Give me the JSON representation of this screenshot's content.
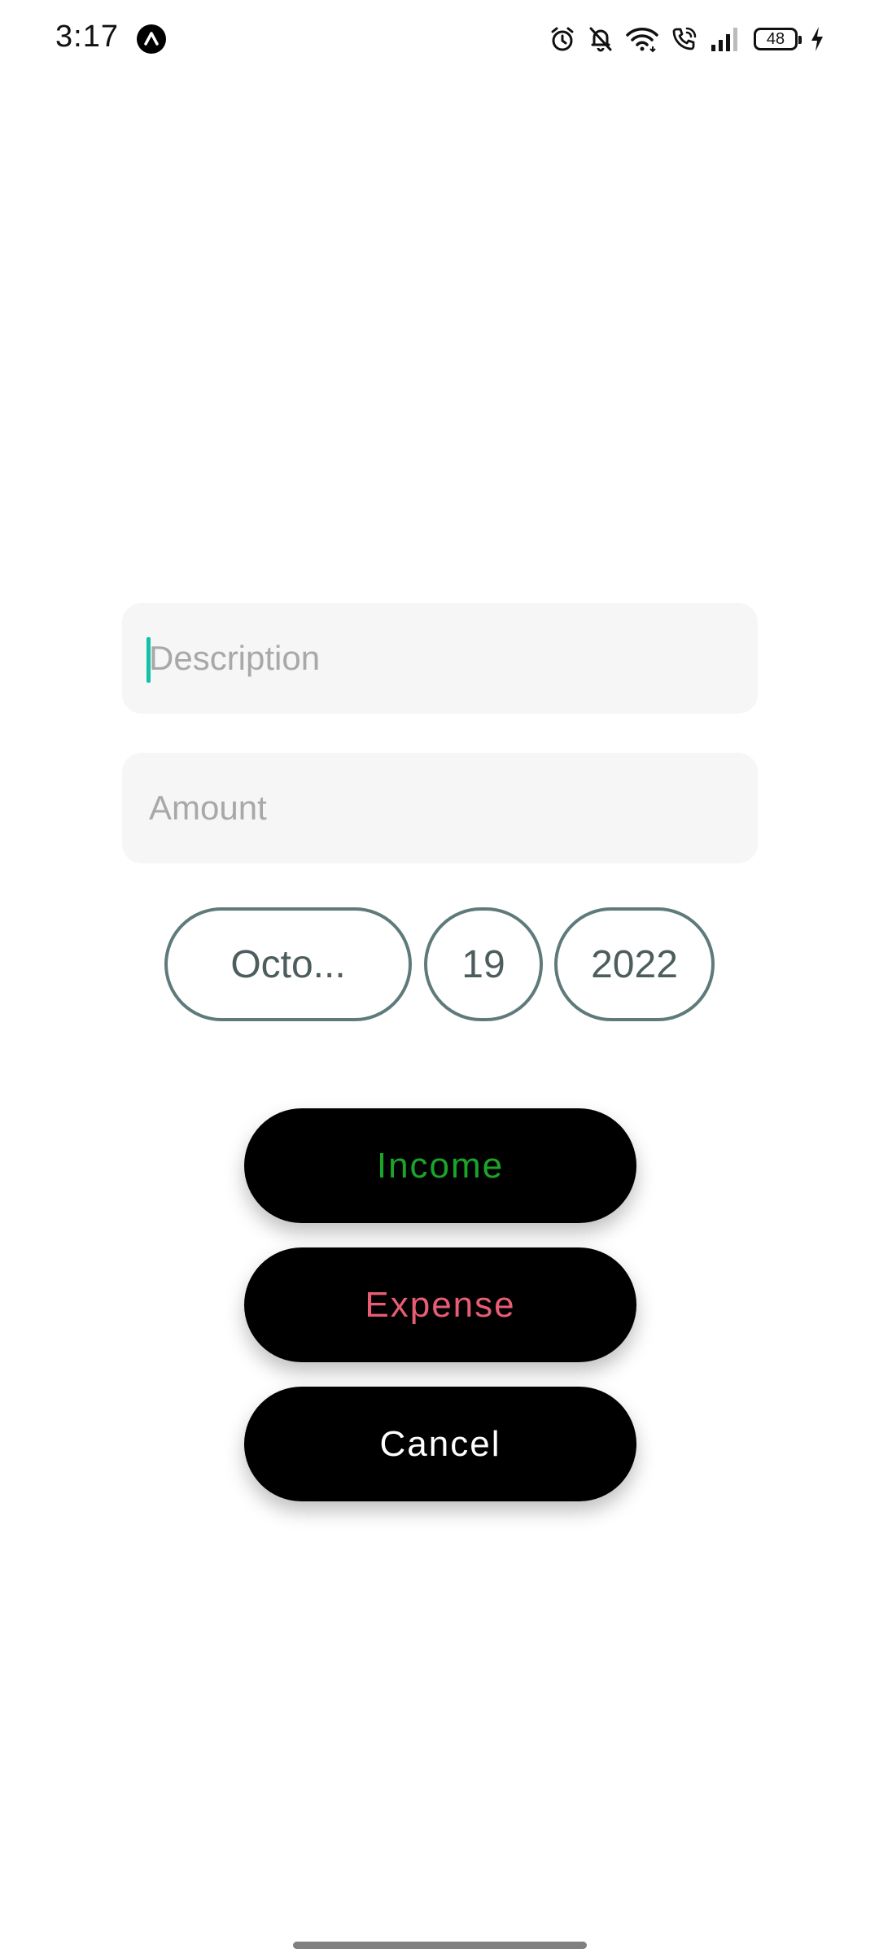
{
  "status_bar": {
    "time": "3:17",
    "battery_level": "48",
    "icons": [
      "expo-icon",
      "alarm-icon",
      "bell-off-icon",
      "wifi-icon",
      "wifi-calling-icon",
      "signal-icon",
      "battery-icon",
      "charging-icon"
    ]
  },
  "form": {
    "description_placeholder": "Description",
    "description_value": "",
    "amount_placeholder": "Amount",
    "amount_value": ""
  },
  "date": {
    "month": "Octo...",
    "day": "19",
    "year": "2022"
  },
  "buttons": {
    "income": "Income",
    "expense": "Expense",
    "cancel": "Cancel"
  },
  "colors": {
    "income": "#1aa52a",
    "expense": "#e85d74",
    "cancel": "#ffffff",
    "pill_border": "#5f7a7a",
    "cursor": "#12c2a8"
  }
}
